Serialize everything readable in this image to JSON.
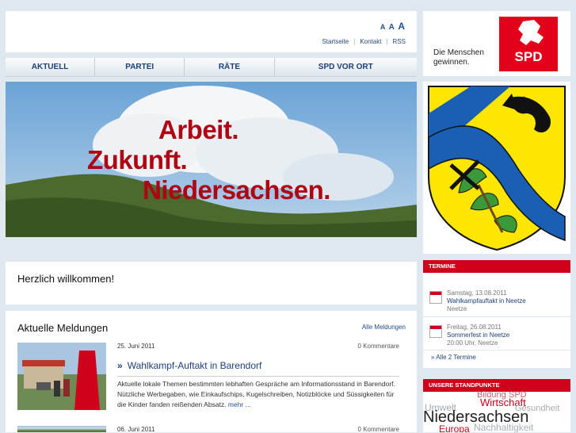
{
  "header": {
    "font_sizes": [
      "A",
      "A",
      "A"
    ],
    "links": [
      "Startseite",
      "Kontakt",
      "RSS"
    ]
  },
  "logo": {
    "slogan_line1": "Die Menschen",
    "slogan_line2": "gewinnen.",
    "brand": "SPD",
    "brand_color": "#e3001b"
  },
  "nav": [
    "AKTUELL",
    "PARTEI",
    "RÄTE",
    "SPD VOR ORT"
  ],
  "hero": {
    "line1": "Arbeit.",
    "line2": "Zukunft.",
    "line3": "Niedersachsen."
  },
  "welcome": {
    "title": "Herzlich willkommen!"
  },
  "news": {
    "heading": "Aktuelle Meldungen",
    "all_link": "Alle Meldungen",
    "items": [
      {
        "date": "25. Juni 2011",
        "comments": "0 Kommentare",
        "title": "Wahlkampf-Auftakt in Barendorf",
        "teaser": "Aktuelle lokale Themen bestimmten lebhaften Gespräche am Informationsstand in Barendorf. Nützliche Werbegaben, wie Einkaufschips, Kugelschreiben, Notizblöcke und Süssigkeiten für die Kinder fanden reißenden Absatz.",
        "more": "mehr ..."
      },
      {
        "date": "06. Juni 2011",
        "comments": "0 Kommentare"
      }
    ]
  },
  "termine": {
    "heading": "TERMINE",
    "events": [
      {
        "date": "Samstag, 13.08.2011",
        "title": "Wahlkampfauftakt in Neetze",
        "place": "Neetze"
      },
      {
        "date": "Freitag, 26.08.2011",
        "title": "Sommerfest in Neetze",
        "place": "20:00 Uhr,  Neetze"
      }
    ],
    "all_link": "Alle 2 Termine"
  },
  "standpunkte": {
    "heading": "UNSERE STANDPUNKTE",
    "tags": [
      "Bildung",
      "SPD",
      "Wirtschaft",
      "Umwelt",
      "Gesundheit",
      "Niedersachsen",
      "Europa",
      "Nachhaltigkeit"
    ]
  },
  "colors": {
    "accent_red": "#d0021b",
    "link_blue": "#1e3f78",
    "background": "#dfe8ee"
  }
}
